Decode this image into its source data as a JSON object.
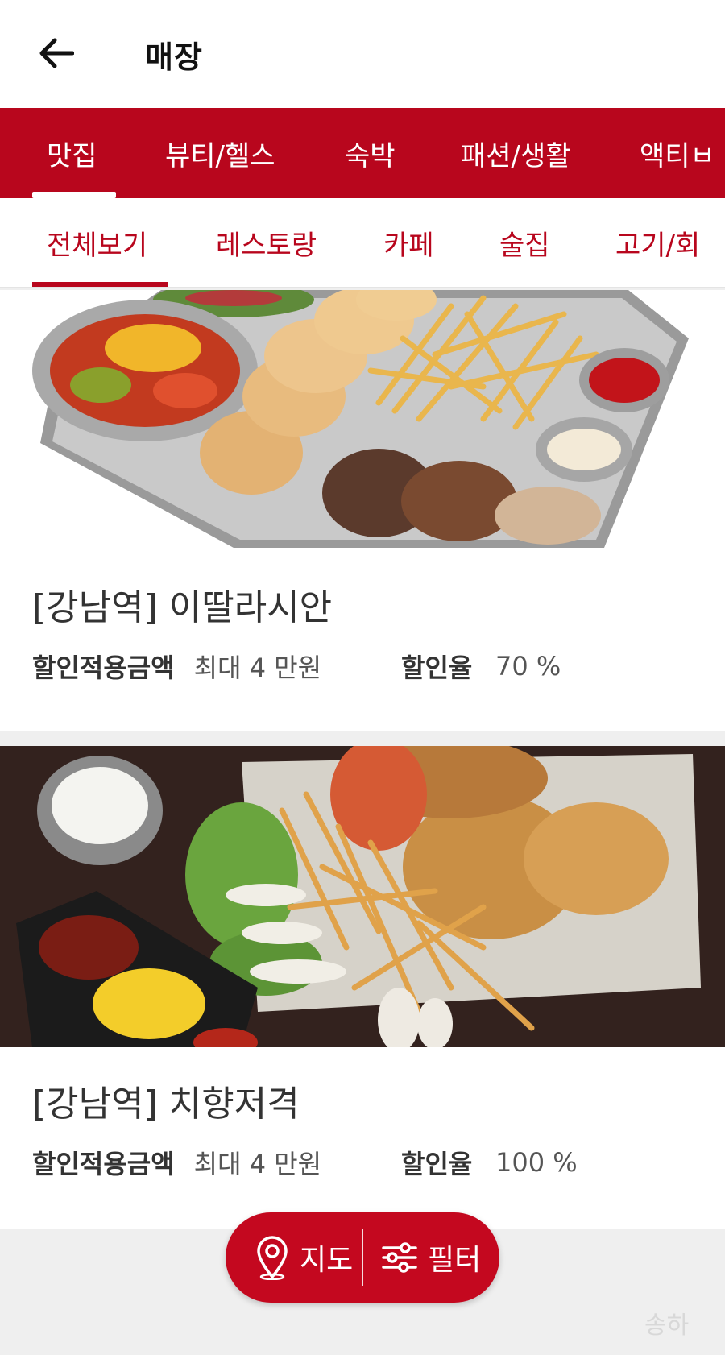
{
  "header": {
    "title": "매장"
  },
  "categories": [
    {
      "label": "맛집",
      "active": true
    },
    {
      "label": "뷰티/헬스"
    },
    {
      "label": "숙박"
    },
    {
      "label": "패션/생활"
    },
    {
      "label": "액티ㅂ"
    }
  ],
  "subcategories": [
    {
      "label": "전체보기",
      "active": true
    },
    {
      "label": "레스토랑"
    },
    {
      "label": "카페"
    },
    {
      "label": "술집"
    },
    {
      "label": "고기/회"
    }
  ],
  "stores": [
    {
      "name": "[강남역] 이딸라시안",
      "discount_amount_label": "할인적용금액",
      "discount_amount": "최대 4 만원",
      "discount_rate_label": "할인율",
      "discount_rate": "70 %"
    },
    {
      "name": "[강남역] 치향저격",
      "discount_amount_label": "할인적용금액",
      "discount_amount": "최대 4 만원",
      "discount_rate_label": "할인율",
      "discount_rate": "100 %"
    }
  ],
  "fab": {
    "map_label": "지도",
    "filter_label": "필터"
  },
  "watermark": "송하",
  "colors": {
    "brand_red": "#b8061d",
    "fab_red": "#c4081f"
  }
}
